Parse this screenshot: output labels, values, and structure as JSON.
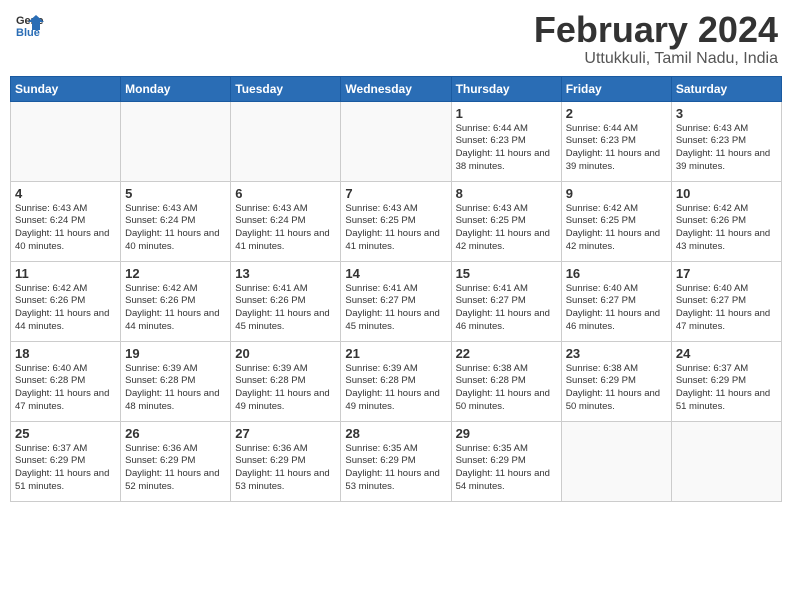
{
  "header": {
    "logo_general": "General",
    "logo_blue": "Blue",
    "title": "February 2024",
    "subtitle": "Uttukkuli, Tamil Nadu, India"
  },
  "days_of_week": [
    "Sunday",
    "Monday",
    "Tuesday",
    "Wednesday",
    "Thursday",
    "Friday",
    "Saturday"
  ],
  "weeks": [
    [
      {
        "day": "",
        "info": ""
      },
      {
        "day": "",
        "info": ""
      },
      {
        "day": "",
        "info": ""
      },
      {
        "day": "",
        "info": ""
      },
      {
        "day": "1",
        "info": "Sunrise: 6:44 AM\nSunset: 6:23 PM\nDaylight: 11 hours\nand 38 minutes."
      },
      {
        "day": "2",
        "info": "Sunrise: 6:44 AM\nSunset: 6:23 PM\nDaylight: 11 hours\nand 39 minutes."
      },
      {
        "day": "3",
        "info": "Sunrise: 6:43 AM\nSunset: 6:23 PM\nDaylight: 11 hours\nand 39 minutes."
      }
    ],
    [
      {
        "day": "4",
        "info": "Sunrise: 6:43 AM\nSunset: 6:24 PM\nDaylight: 11 hours\nand 40 minutes."
      },
      {
        "day": "5",
        "info": "Sunrise: 6:43 AM\nSunset: 6:24 PM\nDaylight: 11 hours\nand 40 minutes."
      },
      {
        "day": "6",
        "info": "Sunrise: 6:43 AM\nSunset: 6:24 PM\nDaylight: 11 hours\nand 41 minutes."
      },
      {
        "day": "7",
        "info": "Sunrise: 6:43 AM\nSunset: 6:25 PM\nDaylight: 11 hours\nand 41 minutes."
      },
      {
        "day": "8",
        "info": "Sunrise: 6:43 AM\nSunset: 6:25 PM\nDaylight: 11 hours\nand 42 minutes."
      },
      {
        "day": "9",
        "info": "Sunrise: 6:42 AM\nSunset: 6:25 PM\nDaylight: 11 hours\nand 42 minutes."
      },
      {
        "day": "10",
        "info": "Sunrise: 6:42 AM\nSunset: 6:26 PM\nDaylight: 11 hours\nand 43 minutes."
      }
    ],
    [
      {
        "day": "11",
        "info": "Sunrise: 6:42 AM\nSunset: 6:26 PM\nDaylight: 11 hours\nand 44 minutes."
      },
      {
        "day": "12",
        "info": "Sunrise: 6:42 AM\nSunset: 6:26 PM\nDaylight: 11 hours\nand 44 minutes."
      },
      {
        "day": "13",
        "info": "Sunrise: 6:41 AM\nSunset: 6:26 PM\nDaylight: 11 hours\nand 45 minutes."
      },
      {
        "day": "14",
        "info": "Sunrise: 6:41 AM\nSunset: 6:27 PM\nDaylight: 11 hours\nand 45 minutes."
      },
      {
        "day": "15",
        "info": "Sunrise: 6:41 AM\nSunset: 6:27 PM\nDaylight: 11 hours\nand 46 minutes."
      },
      {
        "day": "16",
        "info": "Sunrise: 6:40 AM\nSunset: 6:27 PM\nDaylight: 11 hours\nand 46 minutes."
      },
      {
        "day": "17",
        "info": "Sunrise: 6:40 AM\nSunset: 6:27 PM\nDaylight: 11 hours\nand 47 minutes."
      }
    ],
    [
      {
        "day": "18",
        "info": "Sunrise: 6:40 AM\nSunset: 6:28 PM\nDaylight: 11 hours\nand 47 minutes."
      },
      {
        "day": "19",
        "info": "Sunrise: 6:39 AM\nSunset: 6:28 PM\nDaylight: 11 hours\nand 48 minutes."
      },
      {
        "day": "20",
        "info": "Sunrise: 6:39 AM\nSunset: 6:28 PM\nDaylight: 11 hours\nand 49 minutes."
      },
      {
        "day": "21",
        "info": "Sunrise: 6:39 AM\nSunset: 6:28 PM\nDaylight: 11 hours\nand 49 minutes."
      },
      {
        "day": "22",
        "info": "Sunrise: 6:38 AM\nSunset: 6:28 PM\nDaylight: 11 hours\nand 50 minutes."
      },
      {
        "day": "23",
        "info": "Sunrise: 6:38 AM\nSunset: 6:29 PM\nDaylight: 11 hours\nand 50 minutes."
      },
      {
        "day": "24",
        "info": "Sunrise: 6:37 AM\nSunset: 6:29 PM\nDaylight: 11 hours\nand 51 minutes."
      }
    ],
    [
      {
        "day": "25",
        "info": "Sunrise: 6:37 AM\nSunset: 6:29 PM\nDaylight: 11 hours\nand 51 minutes."
      },
      {
        "day": "26",
        "info": "Sunrise: 6:36 AM\nSunset: 6:29 PM\nDaylight: 11 hours\nand 52 minutes."
      },
      {
        "day": "27",
        "info": "Sunrise: 6:36 AM\nSunset: 6:29 PM\nDaylight: 11 hours\nand 53 minutes."
      },
      {
        "day": "28",
        "info": "Sunrise: 6:35 AM\nSunset: 6:29 PM\nDaylight: 11 hours\nand 53 minutes."
      },
      {
        "day": "29",
        "info": "Sunrise: 6:35 AM\nSunset: 6:29 PM\nDaylight: 11 hours\nand 54 minutes."
      },
      {
        "day": "",
        "info": ""
      },
      {
        "day": "",
        "info": ""
      }
    ]
  ]
}
